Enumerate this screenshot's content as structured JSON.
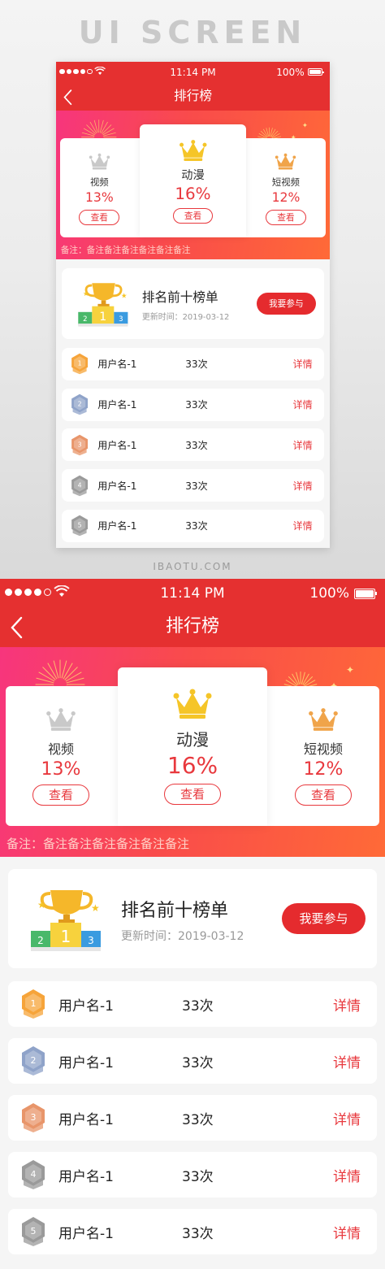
{
  "page": {
    "title": "UI SCREEN",
    "watermark": "IBAOTU.COM"
  },
  "status": {
    "time": "11:14 PM",
    "battery": "100%"
  },
  "nav": {
    "title": "排行榜"
  },
  "categories": [
    {
      "label": "视频",
      "percent": "13%",
      "button": "查看",
      "crown_color": "#c9c9c9"
    },
    {
      "label": "动漫",
      "percent": "16%",
      "button": "查看",
      "crown_color": "#f5c528"
    },
    {
      "label": "短视频",
      "percent": "12%",
      "button": "查看",
      "crown_color": "#f0a44a"
    }
  ],
  "note": "备注：备注备注备注备注备注备注",
  "top10": {
    "title": "排名前十榜单",
    "updated": "更新时间：2019-03-12",
    "join_button": "我要参与"
  },
  "rankings": [
    {
      "rank": "1",
      "name": "用户名-1",
      "count": "33次",
      "action": "详情",
      "badge_color": "#f6a43a"
    },
    {
      "rank": "2",
      "name": "用户名-1",
      "count": "33次",
      "action": "详情",
      "badge_color": "#8fa3c9"
    },
    {
      "rank": "3",
      "name": "用户名-1",
      "count": "33次",
      "action": "详情",
      "badge_color": "#e8956a"
    },
    {
      "rank": "4",
      "name": "用户名-1",
      "count": "33次",
      "action": "详情",
      "badge_color": "#9a9a9a"
    },
    {
      "rank": "5",
      "name": "用户名-1",
      "count": "33次",
      "action": "详情",
      "badge_color": "#9a9a9a"
    }
  ],
  "colors": {
    "accent": "#e8383d",
    "header": "#e53030"
  }
}
